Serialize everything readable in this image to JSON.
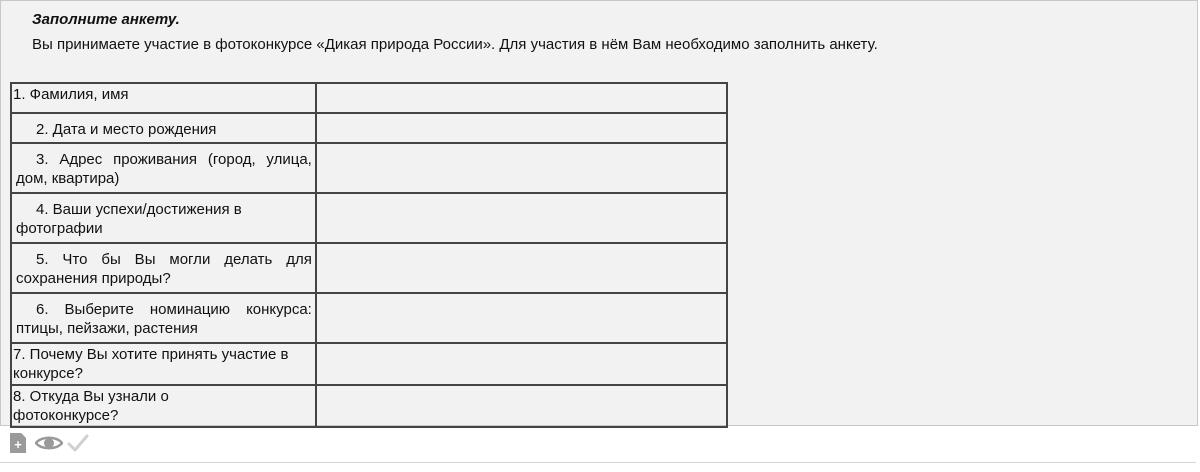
{
  "header": {
    "title": "Заполните анкету.",
    "intro": "Вы принимаете участие в фотоконкурсе «Дикая природа России». Для участия в нём Вам необходимо заполнить анкету."
  },
  "form": {
    "rows": [
      {
        "question": "1. Фамилия, имя",
        "answer": ""
      },
      {
        "question": "2. Дата и место рождения",
        "answer": ""
      },
      {
        "question": "3. Адрес проживания (город, улица, дом, квартира)",
        "answer": ""
      },
      {
        "question": "4. Ваши успехи/достижения в фотографии",
        "answer": ""
      },
      {
        "question": "5. Что бы Вы могли делать для сохранения природы?",
        "answer": ""
      },
      {
        "question": "6. Выберите номинацию конкурса: птицы, пейзажи, растения",
        "answer": ""
      },
      {
        "question": "7. Почему Вы хотите принять участие в конкурсе?",
        "answer": ""
      },
      {
        "question": "8. Откуда Вы узнали о фотоконкурсе?",
        "answer": ""
      }
    ]
  },
  "toolbar": {
    "add_icon": "add-document-icon",
    "add_symbol": "+",
    "view_icon": "eye-icon",
    "check_icon": "checkmark-icon"
  }
}
